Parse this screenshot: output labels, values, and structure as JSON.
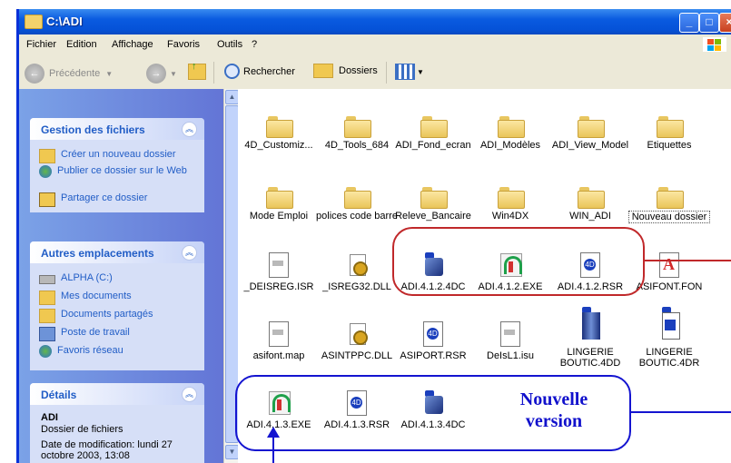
{
  "window": {
    "title": "C:\\ADI"
  },
  "menu": [
    "Fichier",
    "Edition",
    "Affichage",
    "Favoris",
    "Outils",
    "?"
  ],
  "toolbar": {
    "back": "Précédente",
    "search": "Rechercher",
    "folders": "Dossiers"
  },
  "left_panels": {
    "files": {
      "title": "Gestion des fichiers",
      "items": [
        "Créer un nouveau dossier",
        "Publier ce dossier sur le Web",
        "Partager ce dossier"
      ]
    },
    "places": {
      "title": "Autres emplacements",
      "items": [
        "ALPHA (C:)",
        "Mes documents",
        "Documents partagés",
        "Poste de travail",
        "Favoris réseau"
      ]
    },
    "details": {
      "title": "Détails",
      "name": "ADI",
      "type": "Dossier de fichiers",
      "date": "Date de modification: lundi 27 octobre 2003, 13:08"
    }
  },
  "items": [
    "4D_Customiz...",
    "4D_Tools_684",
    "ADI_Fond_ecran",
    "ADI_Modèles",
    "ADI_View_Model",
    "Etiquettes",
    "Mode Emploi",
    "polices code barre",
    "Releve_Bancaire",
    "Win4DX",
    "WIN_ADI",
    "Nouveau dossier",
    "_DEISREG.ISR",
    "_ISREG32.DLL",
    "ADI.4.1.2.4DC",
    "ADI.4.1.2.EXE",
    "ADI.4.1.2.RSR",
    "ASIFONT.FON",
    "asifont.map",
    "ASINTPPC.DLL",
    "ASIPORT.RSR",
    "DeIsL1.isu",
    "LINGERIE BOUTIC.4DD",
    "LINGERIE BOUTIC.4DR",
    "ADI.4.1.3.EXE",
    "ADI.4.1.3.RSR",
    "ADI.4.1.3.4DC"
  ],
  "annotation": {
    "label_line1": "Nouvelle",
    "label_line2": "version",
    "old_color": "#c0282a",
    "new_color": "#1414d0"
  }
}
